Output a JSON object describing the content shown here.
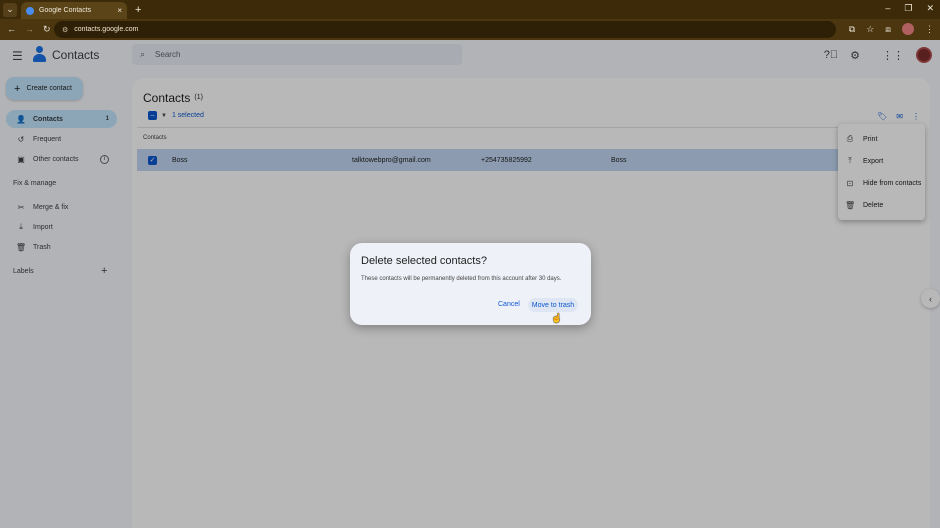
{
  "browser": {
    "tab_title": "Google Contacts",
    "url": "contacts.google.com",
    "new_tab": "+",
    "tab_close": "×"
  },
  "app": {
    "title": "Contacts",
    "search_placeholder": "Search"
  },
  "sidebar": {
    "create_label": "Create contact",
    "items": [
      {
        "label": "Contacts",
        "count": "1"
      },
      {
        "label": "Frequent"
      },
      {
        "label": "Other contacts"
      }
    ],
    "fix_manage_label": "Fix & manage",
    "fix_items": [
      {
        "label": "Merge & fix"
      },
      {
        "label": "Import"
      },
      {
        "label": "Trash"
      }
    ],
    "labels_label": "Labels"
  },
  "main": {
    "title": "Contacts",
    "count": "(1)",
    "selected_text": "1 selected",
    "column_header": "Contacts",
    "rows": [
      {
        "name": "Boss",
        "email": "talktowebpro@gmail.com",
        "phone": "+254735825992",
        "label": "Boss"
      }
    ]
  },
  "menu": {
    "items": [
      {
        "label": "Print",
        "icon": "print-icon"
      },
      {
        "label": "Export",
        "icon": "export-icon"
      },
      {
        "label": "Hide from contacts",
        "icon": "hide-icon"
      },
      {
        "label": "Delete",
        "icon": "delete-icon"
      }
    ]
  },
  "dialog": {
    "title": "Delete selected contacts?",
    "body": "These contacts will be permanently deleted from this account after 30 days.",
    "cancel_label": "Cancel",
    "confirm_label": "Move to trash"
  },
  "colors": {
    "accent": "#0b57d0",
    "selection": "#c2e7ff",
    "chrome": "#3c2a08"
  }
}
